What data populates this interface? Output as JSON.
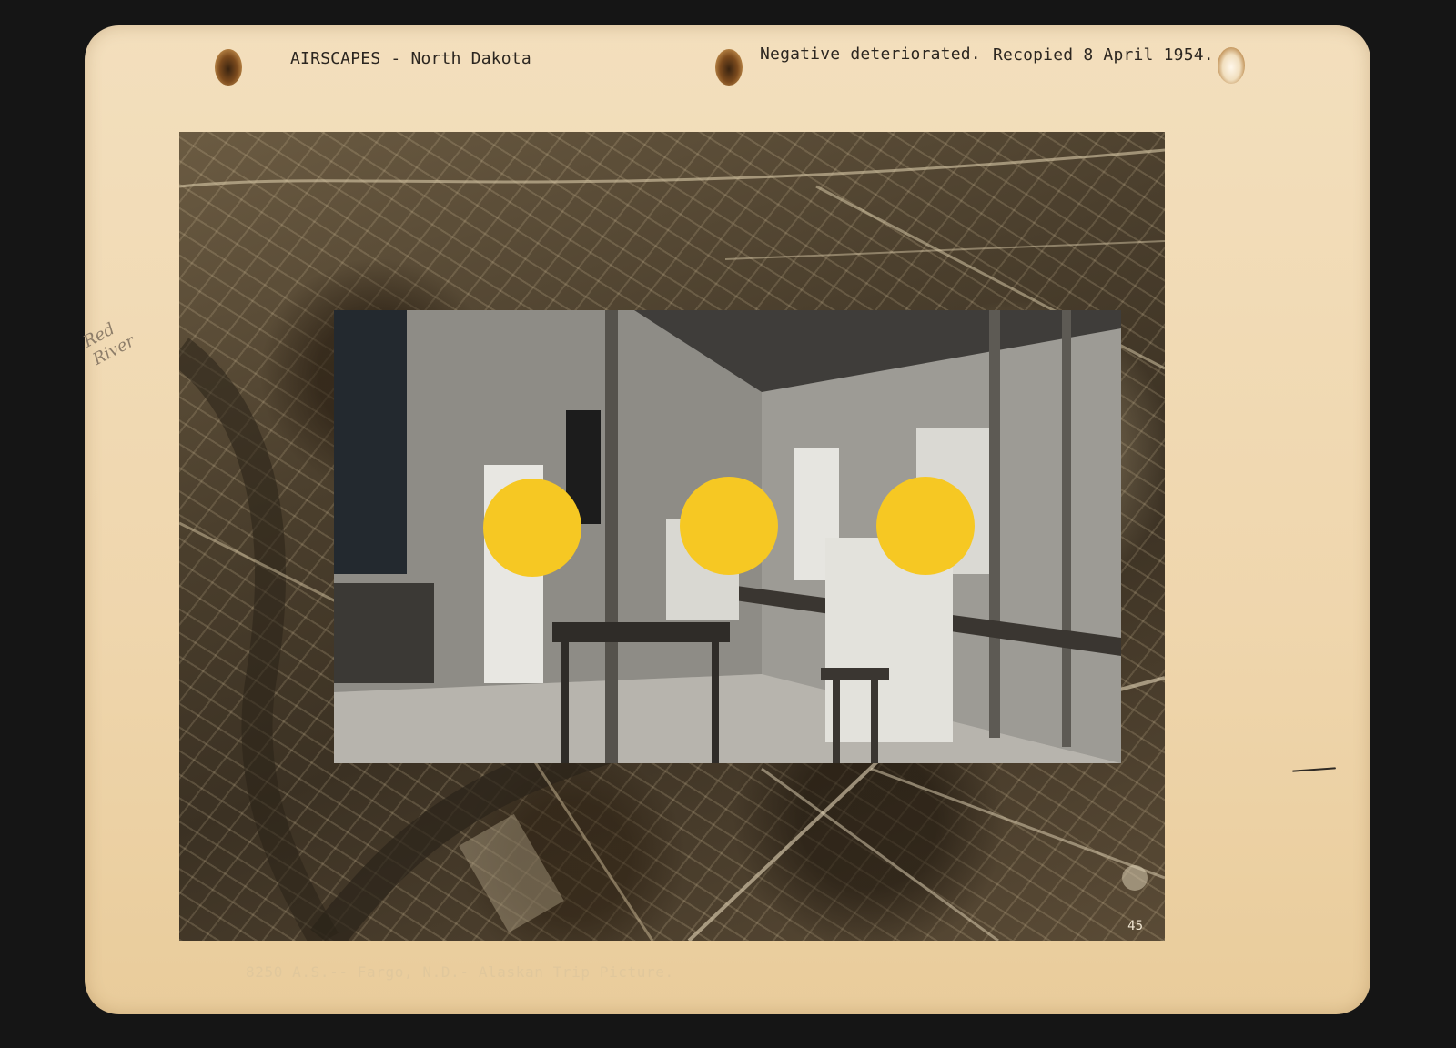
{
  "header": {
    "title": "AIRSCAPES - North Dakota",
    "note": "Negative deteriorated.",
    "recopied": "Recopied 8 April 1954."
  },
  "annotation": {
    "handwriting_line1": "Red",
    "handwriting_line2": "River"
  },
  "photo": {
    "frame_number": "45"
  },
  "caption": "8250 A.S.-- Fargo, N.D.- Alaskan Trip Picture.",
  "colors": {
    "card": "#efd6ad",
    "face_dot": "#f6c823",
    "background": "#151515"
  }
}
